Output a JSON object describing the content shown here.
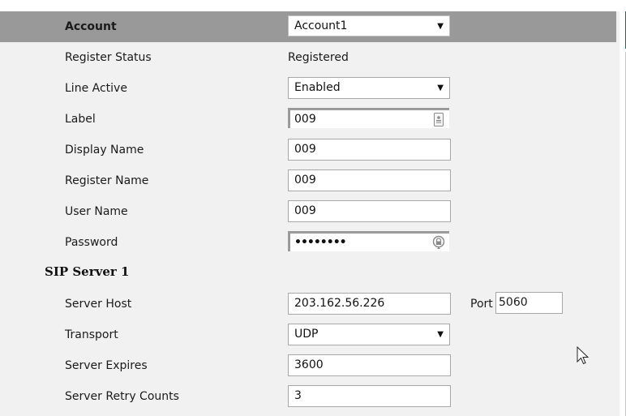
{
  "account": {
    "label": "Account",
    "selected": "Account1"
  },
  "fields": {
    "register_status": {
      "label": "Register Status",
      "value": "Registered"
    },
    "line_active": {
      "label": "Line Active",
      "value": "Enabled"
    },
    "label_field": {
      "label": "Label",
      "value": "009",
      "icon": "contact-card-icon"
    },
    "display_name": {
      "label": "Display Name",
      "value": "009"
    },
    "register_name": {
      "label": "Register Name",
      "value": "009"
    },
    "user_name": {
      "label": "User Name",
      "value": "009"
    },
    "password": {
      "label": "Password",
      "value": "••••••••",
      "icon": "password-lock-icon"
    }
  },
  "sip_server": {
    "title": "SIP Server 1",
    "server_host": {
      "label": "Server Host",
      "value": "203.162.56.226"
    },
    "port": {
      "label": "Port",
      "value": "5060"
    },
    "transport": {
      "label": "Transport",
      "value": "UDP"
    },
    "server_expires": {
      "label": "Server Expires",
      "value": "3600"
    },
    "server_retry_counts": {
      "label": "Server Retry Counts",
      "value": "3"
    }
  },
  "colors": {
    "header_bar": "#999999",
    "panel_bg": "#f1f1f1",
    "accent_green": "#1a6b4f"
  },
  "icons": {
    "dropdown": "caret-down-icon",
    "cursor": "mouse-pointer-icon"
  }
}
